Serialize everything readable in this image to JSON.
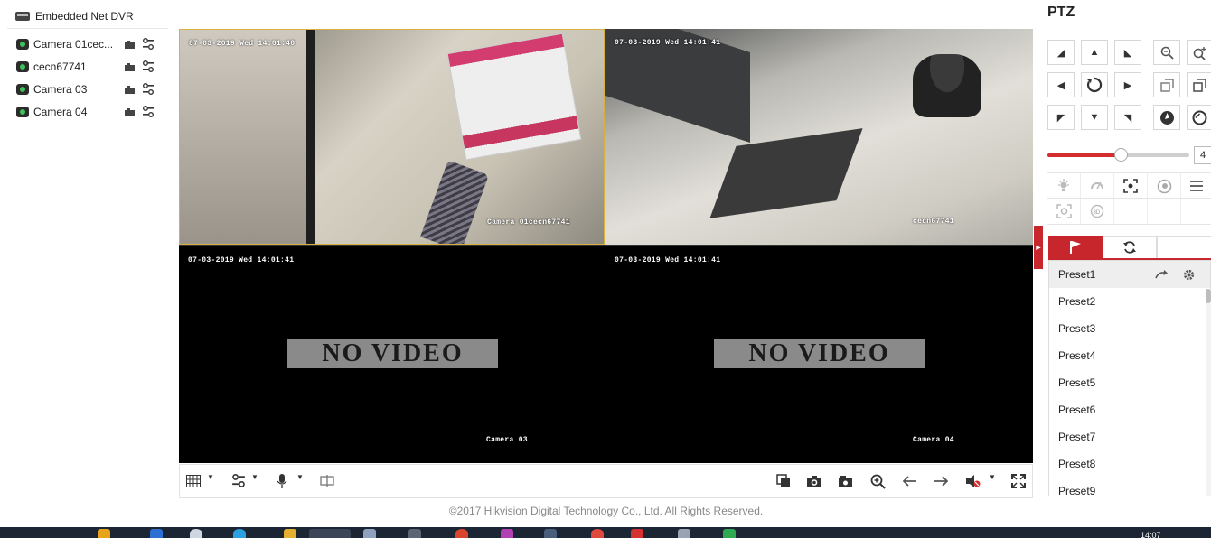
{
  "tree": {
    "root_label": "Embedded Net DVR",
    "cameras": [
      {
        "name": "Camera 01cec..."
      },
      {
        "name": "cecn67741"
      },
      {
        "name": "Camera 03"
      },
      {
        "name": "Camera 04"
      }
    ]
  },
  "video": {
    "panes": [
      {
        "timestamp": "07-03-2019 Wed 14:01:40",
        "label": "Camera 01cecn67741",
        "status": "live"
      },
      {
        "timestamp": "07-03-2019 Wed 14:01:41",
        "label": "cecn67741",
        "status": "live"
      },
      {
        "timestamp": "07-03-2019 Wed 14:01:41",
        "label": "Camera 03",
        "status": "NO VIDEO"
      },
      {
        "timestamp": "07-03-2019 Wed 14:01:41",
        "label": "Camera 04",
        "status": "NO VIDEO"
      }
    ],
    "selected_pane_color": "#d8b040"
  },
  "footer": {
    "copyright": "©2017 Hikvision Digital Technology Co., Ltd. All Rights Reserved."
  },
  "ptz": {
    "title": "PTZ",
    "speed_value": "4",
    "speed_fraction": 0.52,
    "accent_color": "#c8262d",
    "presets": [
      "Preset1",
      "Preset2",
      "Preset3",
      "Preset4",
      "Preset5",
      "Preset6",
      "Preset7",
      "Preset8",
      "Preset9"
    ]
  },
  "taskbar": {
    "clock": "14:07"
  }
}
